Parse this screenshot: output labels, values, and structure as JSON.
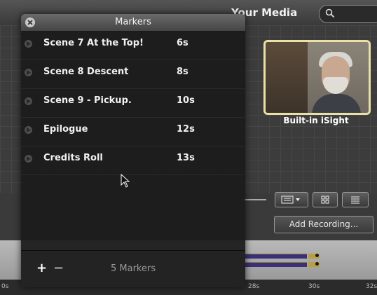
{
  "background": {
    "header_title": "Your Media",
    "search_icon": "search-icon",
    "media_item_label": "Built-in iSight",
    "add_recording_label": "Add Recording...",
    "ruler_ticks": [
      "0s",
      "28s",
      "30s",
      "32s"
    ]
  },
  "markers_panel": {
    "title": "Markers",
    "close_icon": "close-icon",
    "items": [
      {
        "name": "Scene 7 At the Top!",
        "time": "6s"
      },
      {
        "name": "Scene 8 Descent",
        "time": "8s"
      },
      {
        "name": "Scene 9 - Pickup.",
        "time": "10s"
      },
      {
        "name": "Epilogue",
        "time": "12s"
      },
      {
        "name": "Credits Roll",
        "time": "13s"
      }
    ],
    "footer": {
      "add_label": "+",
      "remove_label": "−",
      "count_label": "5 Markers"
    }
  },
  "colors": {
    "thumbnail_border": "#e9e0a8",
    "track_fill": "#3b2f7a",
    "panel_bg": "#1c1c1c"
  }
}
